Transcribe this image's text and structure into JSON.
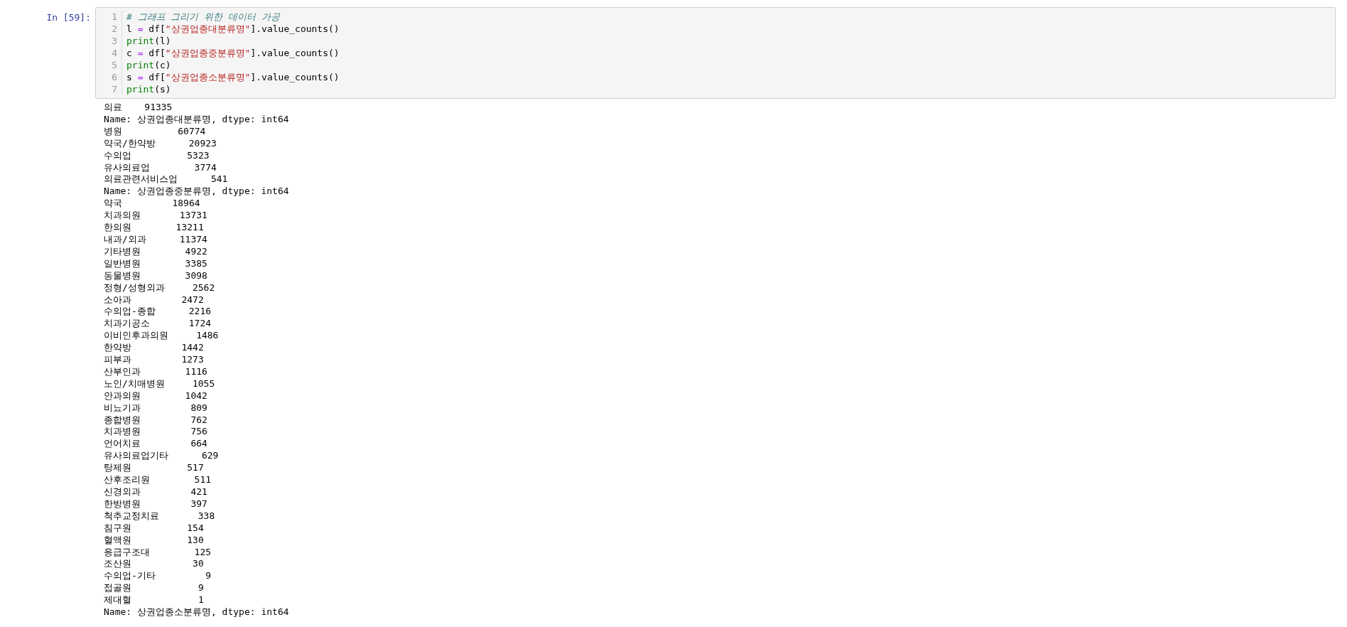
{
  "cell": {
    "prompt": "In [59]:",
    "code": [
      {
        "number": "1",
        "tokens": [
          {
            "kind": "comment",
            "text": "# 그래프 그리기 위한 데이터 가공"
          }
        ]
      },
      {
        "number": "2",
        "tokens": [
          {
            "kind": "plain",
            "text": "l "
          },
          {
            "kind": "op",
            "text": "="
          },
          {
            "kind": "plain",
            "text": " df["
          },
          {
            "kind": "string",
            "text": "\"상권업종대분류명\""
          },
          {
            "kind": "plain",
            "text": "].value_counts()"
          }
        ]
      },
      {
        "number": "3",
        "tokens": [
          {
            "kind": "builtin",
            "text": "print"
          },
          {
            "kind": "plain",
            "text": "(l)"
          }
        ]
      },
      {
        "number": "4",
        "tokens": [
          {
            "kind": "plain",
            "text": "c "
          },
          {
            "kind": "op",
            "text": "="
          },
          {
            "kind": "plain",
            "text": " df["
          },
          {
            "kind": "string",
            "text": "\"상권업종중분류명\""
          },
          {
            "kind": "plain",
            "text": "].value_counts()"
          }
        ]
      },
      {
        "number": "5",
        "tokens": [
          {
            "kind": "builtin",
            "text": "print"
          },
          {
            "kind": "plain",
            "text": "(c)"
          }
        ]
      },
      {
        "number": "6",
        "tokens": [
          {
            "kind": "plain",
            "text": "s "
          },
          {
            "kind": "op",
            "text": "="
          },
          {
            "kind": "plain",
            "text": " df["
          },
          {
            "kind": "string",
            "text": "\"상권업종소분류명\""
          },
          {
            "kind": "plain",
            "text": "].value_counts()"
          }
        ]
      },
      {
        "number": "7",
        "tokens": [
          {
            "kind": "builtin",
            "text": "print"
          },
          {
            "kind": "plain",
            "text": "(s)"
          }
        ]
      }
    ],
    "output": [
      "의료    91335",
      "Name: 상권업종대분류명, dtype: int64",
      "병원          60774",
      "약국/한약방      20923",
      "수의업          5323",
      "유사의료업        3774",
      "의료관련서비스업      541",
      "Name: 상권업종중분류명, dtype: int64",
      "약국         18964",
      "치과의원       13731",
      "한의원        13211",
      "내과/외과      11374",
      "기타병원        4922",
      "일반병원        3385",
      "동물병원        3098",
      "정형/성형외과     2562",
      "소아과         2472",
      "수의업-종합      2216",
      "치과기공소       1724",
      "이비인후과의원     1486",
      "한약방         1442",
      "피부과         1273",
      "산부인과        1116",
      "노인/치매병원     1055",
      "안과의원        1042",
      "비뇨기과         809",
      "종합병원         762",
      "치과병원         756",
      "언어치료         664",
      "유사의료업기타      629",
      "탕제원          517",
      "산후조리원        511",
      "신경외과         421",
      "한방병원         397",
      "척추교정치료       338",
      "침구원          154",
      "혈액원          130",
      "응급구조대        125",
      "조산원           30",
      "수의업-기타         9",
      "접골원            9",
      "제대혈            1",
      "Name: 상권업종소분류명, dtype: int64"
    ]
  }
}
